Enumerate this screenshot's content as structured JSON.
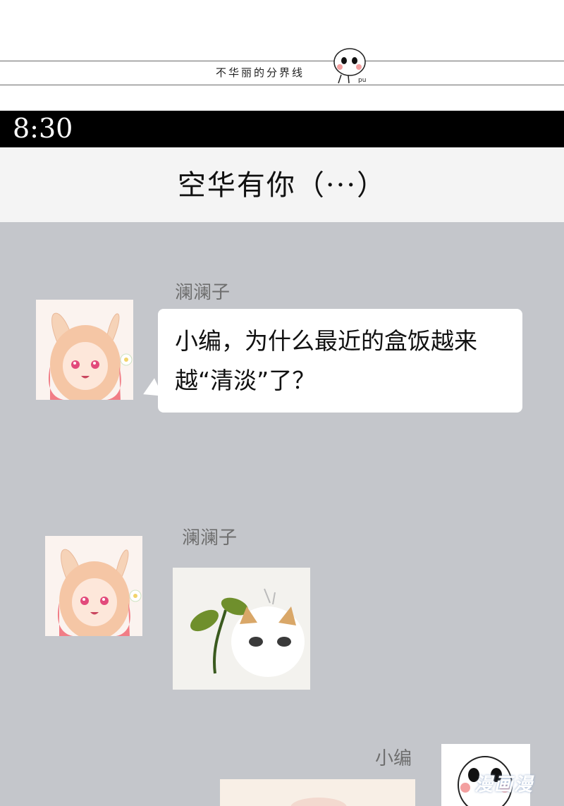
{
  "divider": {
    "text": "不华丽的分界线",
    "face_label": "pu"
  },
  "status_bar": {
    "time": "8:30"
  },
  "chat": {
    "title": "空华有你（···）"
  },
  "messages": [
    {
      "sender": "澜澜子",
      "type": "text",
      "text": "小编，为什么最近的盒饭越来越“清淡”了？"
    },
    {
      "sender": "澜澜子",
      "type": "sticker",
      "sticker": "sprout-cat-sticker"
    },
    {
      "sender": "小编",
      "type": "image",
      "sticker": "partial-image"
    }
  ],
  "watermark": {
    "text": "漫画漫"
  },
  "colors": {
    "chat_bg": "#c4c6cb",
    "header_bg": "#f4f4f4",
    "status_bg": "#000000",
    "bubble_bg": "#ffffff"
  }
}
